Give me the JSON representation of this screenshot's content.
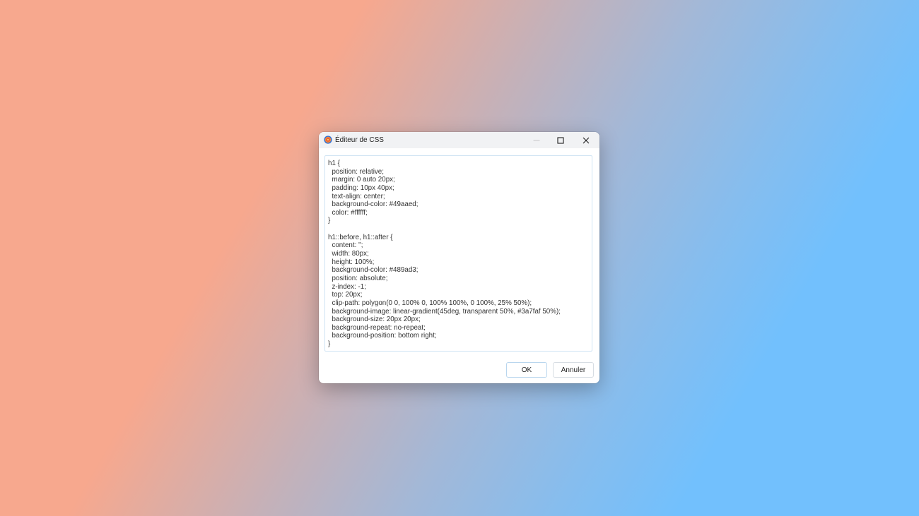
{
  "window": {
    "title": "Éditeur de CSS",
    "icon": "app-logo-icon",
    "controls": [
      "minimize-icon",
      "maximize-icon",
      "close-icon"
    ]
  },
  "editor": {
    "lines": [
      "h1 {",
      "  position: relative;",
      "  margin: 0 auto 20px;",
      "  padding: 10px 40px;",
      "  text-align: center;",
      "  background-color: #49aaed;",
      "  color: #ffffff;",
      "}",
      "",
      "h1::before, h1::after {",
      "  content: '';",
      "  width: 80px;",
      "  height: 100%;",
      "  background-color: #489ad3;",
      "  position: absolute;",
      "  z-index: -1;",
      "  top: 20px;",
      "  clip-path: polygon(0 0, 100% 0, 100% 100%, 0 100%, 25% 50%);",
      "  background-image: linear-gradient(45deg, transparent 50%, #3a7faf 50%);",
      "  background-size: 20px 20px;",
      "  background-repeat: no-repeat;",
      "  background-position: bottom right;",
      "}"
    ]
  },
  "buttons": {
    "ok_label": "OK",
    "cancel_label": "Annuler"
  },
  "colors": {
    "background_left": "#f7a88e",
    "background_right": "#72c0fd",
    "titlebar": "#f1f2f4",
    "editor_border": "#cfe3f3"
  }
}
